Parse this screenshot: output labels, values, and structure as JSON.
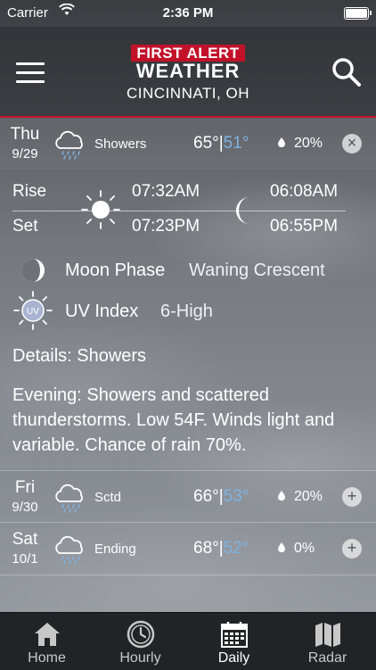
{
  "status_bar": {
    "carrier": "Carrier",
    "time": "2:36 PM"
  },
  "header": {
    "logo_line1": "FIRST ALERT",
    "logo_line2": "WEATHER",
    "city": "CINCINNATI, OH",
    "accent_color": "#c2122a"
  },
  "days": [
    {
      "day": "Thu",
      "date": "9/29",
      "condition": "Showers",
      "high": "65°",
      "low": "51°",
      "precip": "20%",
      "expanded": true,
      "icon": "cloud-rain-icon"
    },
    {
      "day": "Fri",
      "date": "9/30",
      "condition": "Sctd",
      "high": "66°",
      "low": "53°",
      "precip": "20%",
      "expanded": false,
      "icon": "cloud-rain-icon"
    },
    {
      "day": "Sat",
      "date": "10/1",
      "condition": "Ending",
      "high": "68°",
      "low": "52°",
      "precip": "0%",
      "expanded": false,
      "icon": "cloud-rain-icon"
    }
  ],
  "details": {
    "rise_label": "Rise",
    "set_label": "Set",
    "sunrise": "07:32AM",
    "sunset": "07:23PM",
    "moonrise": "06:08AM",
    "moonset": "06:55PM",
    "moon_phase_label": "Moon Phase",
    "moon_phase_value": "Waning Crescent",
    "uv_label": "UV Index",
    "uv_icon_text": "UV",
    "uv_value": "6-High",
    "details_line": "Details: Showers",
    "evening_text": "Evening: Showers and scattered thunderstorms. Low 54F. Winds light and variable. Chance of rain 70%."
  },
  "tabs": [
    {
      "label": "Home",
      "icon": "home-icon",
      "active": false
    },
    {
      "label": "Hourly",
      "icon": "clock-icon",
      "active": false
    },
    {
      "label": "Daily",
      "icon": "calendar-icon",
      "active": true
    },
    {
      "label": "Radar",
      "icon": "map-icon",
      "active": false
    }
  ]
}
